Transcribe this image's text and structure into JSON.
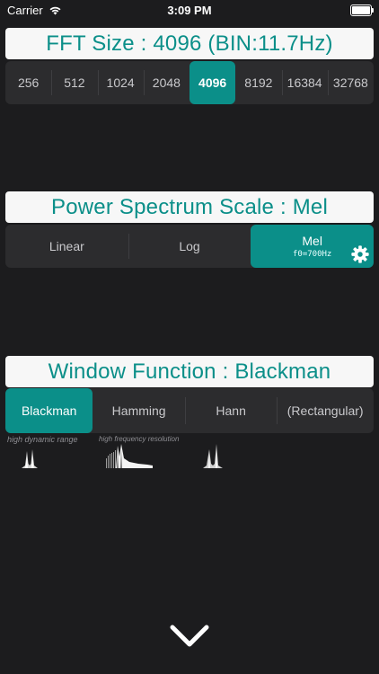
{
  "status": {
    "carrier": "Carrier",
    "time": "3:09 PM"
  },
  "fft": {
    "title": "FFT Size : 4096    (BIN:11.7Hz)",
    "options": [
      "256",
      "512",
      "1024",
      "2048",
      "4096",
      "8192",
      "16384",
      "32768"
    ],
    "selected": "4096"
  },
  "power": {
    "title": "Power Spectrum Scale : Mel",
    "options": [
      "Linear",
      "Log",
      "Mel"
    ],
    "selected": "Mel",
    "mel_sub": "f0=700Hz"
  },
  "window": {
    "title": "Window Function : Blackman",
    "options": [
      "Blackman",
      "Hamming",
      "Hann",
      "(Rectangular)"
    ],
    "selected": "Blackman",
    "captions": [
      "high dynamic range",
      "high frequency resolution"
    ]
  },
  "colors": {
    "accent": "#0b8f89",
    "background": "#1c1c1e",
    "segment_bg": "#2c2c2e"
  },
  "icons": {
    "settings": "gear-icon",
    "collapse": "chevron-down-icon"
  }
}
